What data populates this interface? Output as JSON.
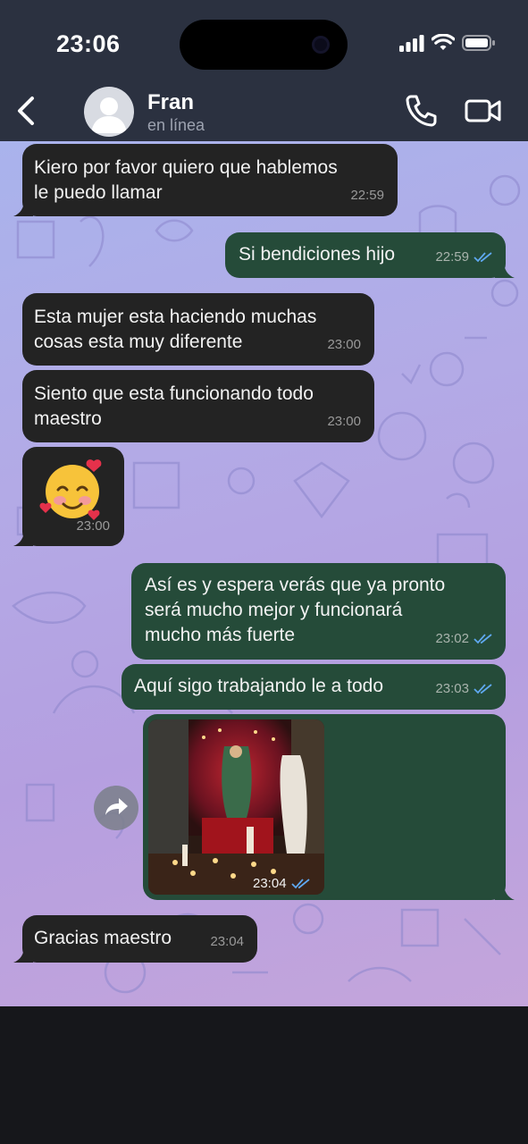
{
  "status_bar": {
    "time": "23:06"
  },
  "contact": {
    "name": "Fran",
    "status": "en línea"
  },
  "messages": [
    {
      "text": "Kiero por favor quiero que hablemos\nle puedo llamar",
      "time": "22:59"
    },
    {
      "text": "Si bendiciones hijo",
      "time": "22:59"
    },
    {
      "text": "Esta mujer esta haciendo muchas\ncosas esta muy diferente",
      "time": "23:00"
    },
    {
      "text": "Siento que esta funcionando todo\nmaestro",
      "time": "23:00"
    },
    {
      "emoji": "🥰",
      "time": "23:00"
    },
    {
      "text": "Así es y espera verás que ya pronto\nserá mucho mejor y funcionará\nmucho más fuerte",
      "time": "23:02"
    },
    {
      "text": "Aquí sigo trabajando le a todo",
      "time": "23:03"
    },
    {
      "photo": "altar-photo",
      "time": "23:04"
    },
    {
      "text": "Gracias maestro",
      "time": "23:04"
    }
  ],
  "colors": {
    "incoming_bubble": "#232323",
    "outgoing_bubble": "#254b39",
    "read_ticks": "#5fa8f0",
    "header": "#2b3140"
  },
  "icons": [
    "back-icon",
    "avatar-icon",
    "phone-icon",
    "video-icon",
    "forward-icon",
    "plus-icon",
    "sticker-icon",
    "camera-icon",
    "microphone-icon"
  ]
}
